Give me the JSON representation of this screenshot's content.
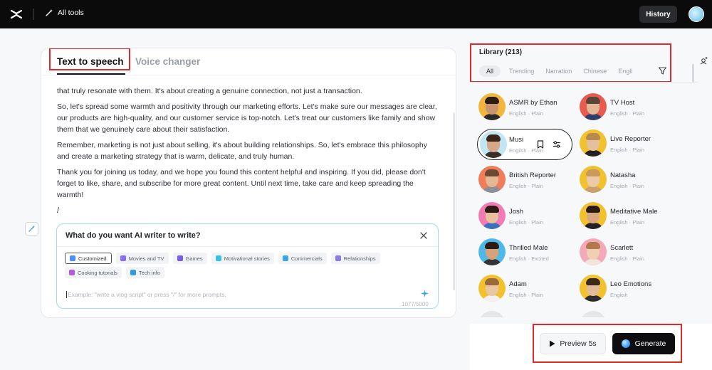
{
  "topbar": {
    "all_tools": "All tools",
    "history": "History"
  },
  "tabs": {
    "tts": "Text to speech",
    "voice_changer": "Voice changer"
  },
  "editor": {
    "lead_line": "that truly resonate with them. It's about creating a genuine connection, not just a transaction.",
    "paragraphs": [
      "So, let's spread some warmth and positivity through our marketing efforts. Let's make sure our messages are clear, our products are high-quality, and our customer service is top-notch. Let's treat our customers like family and show them that we genuinely care about their satisfaction.",
      "Remember, marketing is not just about selling, it's about building relationships. So, let's embrace this philosophy and create a marketing strategy that is warm, delicate, and truly human.",
      "Thank you for joining us today, and we hope you found this content helpful and inspiring. If you did, please don't forget to like, share, and subscribe for more great content. Until next time, take care and keep spreading the warmth!"
    ],
    "slash": "/"
  },
  "writer": {
    "title": "What do you want AI writer to write?",
    "chips": [
      "Customized",
      "Movies and TV",
      "Games",
      "Motivational stories",
      "Commercials",
      "Relationships",
      "Cooking tutorials",
      "Tech info"
    ],
    "placeholder": "Example: \"write a vlog script\" or press \"/\" for more prompts.",
    "counter": "1077/5000"
  },
  "library": {
    "title": "Library (213)",
    "filters": [
      "All",
      "Trending",
      "Narration",
      "Chinese",
      "Engli"
    ],
    "voices": [
      {
        "name": "ASMR by Ethan",
        "meta": "English · Plain"
      },
      {
        "name": "TV Host",
        "meta": "English · Plain"
      },
      {
        "name": "Musi",
        "meta": "English · Plain"
      },
      {
        "name": "Live Reporter",
        "meta": "English · Plain"
      },
      {
        "name": "British Reporter",
        "meta": "English · Plain"
      },
      {
        "name": "Natasha",
        "meta": "English · Plain"
      },
      {
        "name": "Josh",
        "meta": "English · Plain"
      },
      {
        "name": "Meditative Male",
        "meta": "English · Plain"
      },
      {
        "name": "Thrilled Male",
        "meta": "English · Excited"
      },
      {
        "name": "Scarlett",
        "meta": "English · Plain"
      },
      {
        "name": "Adam",
        "meta": "English · Plain"
      },
      {
        "name": "Leo Emotions",
        "meta": "English"
      }
    ]
  },
  "actions": {
    "preview": "Preview 5s",
    "generate": "Generate"
  },
  "colors": {
    "highlight": "#e0292b",
    "accent_border": "#9fdcf0",
    "topbar": "#0b0b0c"
  }
}
